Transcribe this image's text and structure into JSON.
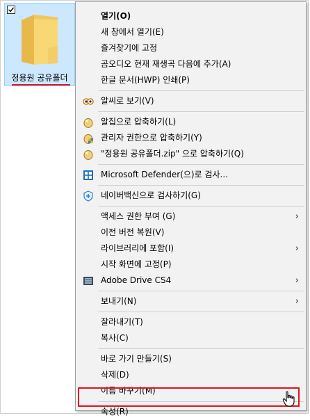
{
  "desktop": {
    "folder_label": "정용원 공유폴더"
  },
  "menu": {
    "items": [
      {
        "label": "열기(O)",
        "bold": true
      },
      {
        "label": "새 창에서 열기(E)"
      },
      {
        "label": "즐겨찾기에 고정"
      },
      {
        "label": "곰오디오 현재 재생곡 다음에 추가(A)"
      },
      {
        "label": "한글 문서(HWP) 인쇄(P)"
      },
      {
        "label": "알씨로 보기(V)",
        "icon": "alsee-icon"
      },
      {
        "label": "알집으로 압축하기(L)",
        "icon": "alzip-icon"
      },
      {
        "label": "관리자 권한으로 압축하기(Y)",
        "icon": "alzip-admin-icon"
      },
      {
        "label": "\"정용원 공유폴더.zip\" 으로 압축하기(Q)",
        "icon": "alzip-icon"
      },
      {
        "label": "Microsoft Defender(으)로 검사...",
        "icon": "defender-shield-icon"
      },
      {
        "label": "네이버백신으로 검사하기(G)",
        "icon": "naver-vaccine-icon"
      },
      {
        "label": "액세스 권한 부여 (G)",
        "submenu": true
      },
      {
        "label": "이전 버전 복원(V)"
      },
      {
        "label": "라이브러리에 포함(I)",
        "submenu": true
      },
      {
        "label": "시작 화면에 고정(P)"
      },
      {
        "label": "Adobe Drive CS4",
        "icon": "adobe-drive-icon",
        "submenu": true
      },
      {
        "label": "보내기(N)",
        "submenu": true
      },
      {
        "label": "잘라내기(T)"
      },
      {
        "label": "복사(C)"
      },
      {
        "label": "바로 가기 만들기(S)"
      },
      {
        "label": "삭제(D)"
      },
      {
        "label": "이름 바꾸기(M)"
      },
      {
        "label": "속성(R)"
      }
    ],
    "submenu_arrow": "›"
  },
  "colors": {
    "highlight_red": "#e0151e",
    "selection_blue": "#cce8ff",
    "menu_bg": "#f2f2f2"
  }
}
